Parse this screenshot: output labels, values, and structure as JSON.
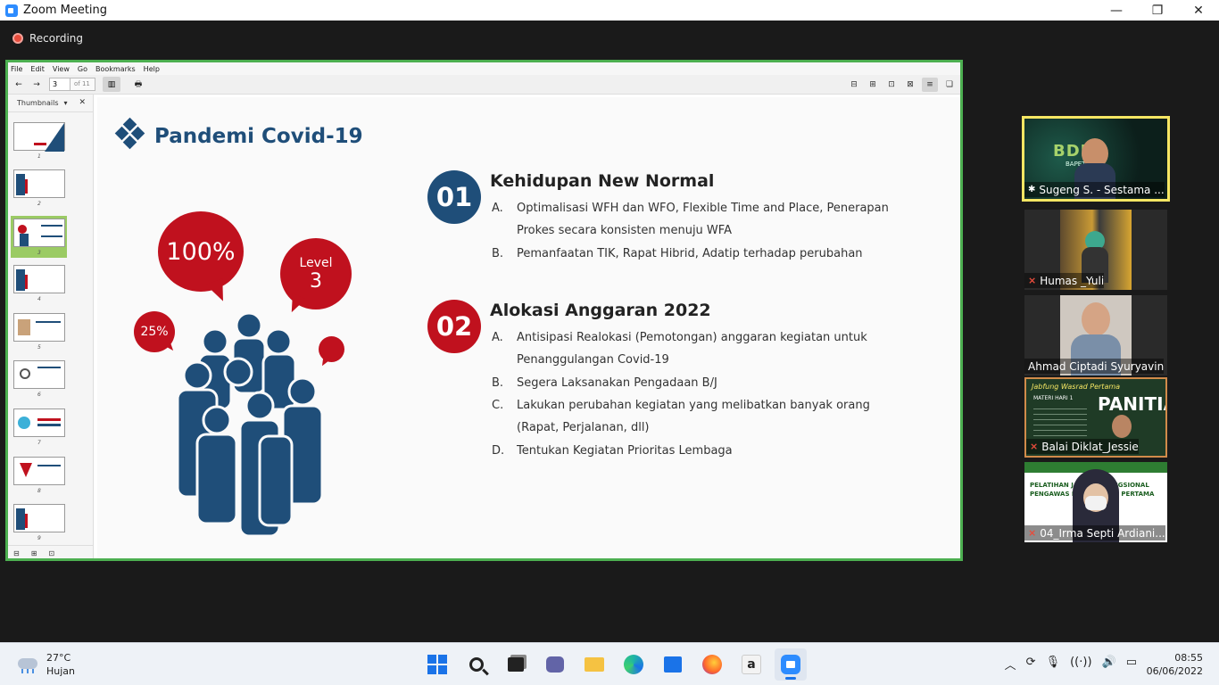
{
  "window": {
    "title": "Zoom Meeting",
    "minimize": "—",
    "restore": "❐",
    "close": "✕"
  },
  "recording": {
    "label": "Recording"
  },
  "viewer": {
    "menu": [
      "File",
      "Edit",
      "View",
      "Go",
      "Bookmarks",
      "Help"
    ],
    "page_current": "3",
    "page_total": "of 11",
    "thumbnails_label": "Thumbnails",
    "thumbnail_numbers": [
      "1",
      "2",
      "3",
      "4",
      "5",
      "6",
      "7",
      "8",
      "9"
    ]
  },
  "slide": {
    "title": "Pandemi Covid-19",
    "bubbles": {
      "big": "100%",
      "level_word": "Level",
      "level_num": "3",
      "small": "25%"
    },
    "sections": [
      {
        "number": "01",
        "title": "Kehidupan New Normal",
        "items": [
          {
            "letter": "A.",
            "text": "Optimalisasi WFH dan WFO, Flexible Time and Place, Penerapan Prokes secara konsisten menuju WFA"
          },
          {
            "letter": "B.",
            "text": "Pemanfaatan TIK, Rapat Hibrid, Adatip terhadap perubahan"
          }
        ]
      },
      {
        "number": "02",
        "title": "Alokasi Anggaran 2022",
        "items": [
          {
            "letter": "A.",
            "text": "Antisipasi Realokasi  (Pemotongan) anggaran kegiatan untuk Penanggulangan Covid-19"
          },
          {
            "letter": "B.",
            "text": "Segera Laksanakan Pengadaan B/J"
          },
          {
            "letter": "C.",
            "text": "Lakukan perubahan kegiatan yang melibatkan banyak orang (Rapat, Perjalanan, dll)"
          },
          {
            "letter": "D.",
            "text": "Tentukan Kegiatan Prioritas Lembaga"
          }
        ]
      }
    ]
  },
  "participants": [
    {
      "name": "Sugeng S. - Sestama ...",
      "muted": false,
      "active": true
    },
    {
      "name": "Humas _Yuli",
      "muted": true
    },
    {
      "name": "Ahmad Ciptadi Syuryavin",
      "muted": false
    },
    {
      "name": "Balai Diklat_Jessie",
      "muted": true
    },
    {
      "name": "04_Irma Septi Ardiani...",
      "muted": true
    }
  ],
  "panel_texts": {
    "sugeng_logo": "BDL",
    "sugeng_logo_sub": "BAPETEN",
    "jessie_board_title": "Jabfung Wasrad Pertama",
    "jessie_board_big": "PANITIA",
    "jessie_board_line": "MATERI HARI 1",
    "irma_banner_1": "PELATIHAN JABATAN FUNGSIONAL",
    "irma_banner_2": "PENGAWAS RADIASI AHLI PERTAMA"
  },
  "taskbar": {
    "weather_temp": "27°C",
    "weather_desc": "Hujan",
    "time": "08:55",
    "date": "06/06/2022"
  },
  "colors": {
    "accent_navy": "#1f4e79",
    "accent_red": "#c0111e",
    "share_border": "#4caf50",
    "active_speaker": "#f5e663"
  }
}
